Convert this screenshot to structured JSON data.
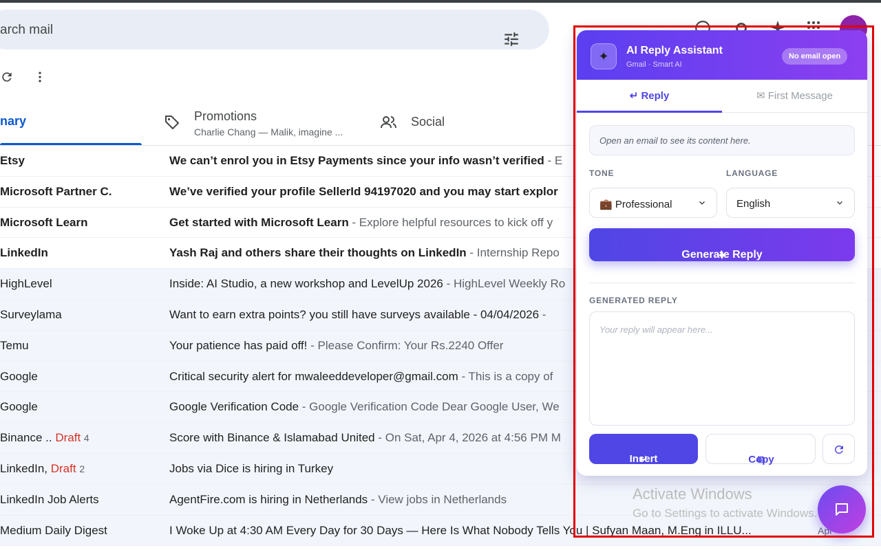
{
  "search": {
    "placeholder": "arch mail"
  },
  "tabs": {
    "primary": "nary",
    "promotions": {
      "label": "Promotions",
      "subtitle": "Charlie Chang — Malik, imagine ..."
    },
    "social": "Social"
  },
  "emails": [
    {
      "sender": "Etsy",
      "draft": "",
      "count": "",
      "subject": "We can’t enrol you in Etsy Payments since your info wasn’t verified",
      "snippet": " - E",
      "unread": true
    },
    {
      "sender": "Microsoft Partner C.",
      "draft": "",
      "count": "",
      "subject": "We’ve verified your profile SellerId 94197020 and you may start explor",
      "snippet": "",
      "unread": true
    },
    {
      "sender": "Microsoft Learn",
      "draft": "",
      "count": "",
      "subject": "Get started with Microsoft Learn",
      "snippet": " - Explore helpful resources to kick off y",
      "unread": true
    },
    {
      "sender": "LinkedIn",
      "draft": "",
      "count": "",
      "subject": "Yash Raj and others share their thoughts on LinkedIn",
      "snippet": " - Internship Repo",
      "unread": true
    },
    {
      "sender": "HighLevel",
      "draft": "",
      "count": "",
      "subject": "Inside: AI Studio, a new workshop and LevelUp 2026",
      "snippet": " - HighLevel Weekly Ro",
      "unread": false
    },
    {
      "sender": "Surveylama",
      "draft": "",
      "count": "",
      "subject": "Want to earn extra points? you still have surveys available - 04/04/2026",
      "snippet": " -",
      "unread": false
    },
    {
      "sender": "Temu",
      "draft": "",
      "count": "",
      "subject": "Your patience has paid off!",
      "snippet": " - Please Confirm: Your Rs.2240 Offer",
      "unread": false
    },
    {
      "sender": "Google",
      "draft": "",
      "count": "",
      "subject": "Critical security alert for mwaleeddeveloper@gmail.com",
      "snippet": " - This is a copy of",
      "unread": false
    },
    {
      "sender": "Google",
      "draft": "",
      "count": "",
      "subject": "Google Verification Code",
      "snippet": " - Google Verification Code Dear Google User, We",
      "unread": false
    },
    {
      "sender": "Binance .. ",
      "draft": "Draft",
      "count": "4",
      "subject": "Score with Binance & Islamabad United",
      "snippet": " - On Sat, Apr 4, 2026 at 4:56 PM M",
      "unread": false
    },
    {
      "sender": "LinkedIn, ",
      "draft": "Draft",
      "count": "2",
      "subject": "Jobs via Dice is hiring in Turkey",
      "snippet": "",
      "unread": false
    },
    {
      "sender": "LinkedIn Job Alerts",
      "draft": "",
      "count": "",
      "subject": "AgentFire.com is hiring in Netherlands",
      "snippet": " - View jobs in Netherlands",
      "unread": false
    },
    {
      "sender": "Medium Daily Digest",
      "draft": "",
      "count": "",
      "subject": "I Woke Up at 4:30 AM Every Day for 30 Days — Here Is What Nobody Tells You | Sufyan Maan, M.Eng in ILLU...",
      "snippet": "",
      "unread": false,
      "date": "Apr"
    }
  ],
  "panel": {
    "title": "AI Reply Assistant",
    "subtitle": "Gmail · Smart AI",
    "status": "No email open",
    "tab_reply": "Reply",
    "tab_first": "First Message",
    "email_placeholder": "Open an email to see its content here.",
    "tone_label": "TONE",
    "language_label": "LANGUAGE",
    "tone_value": "Professional",
    "language_value": "English",
    "generate_label": "Generate Reply",
    "generated_label": "GENERATED REPLY",
    "reply_placeholder": "Your reply will appear here...",
    "insert_label": "Insert",
    "copy_label": "Copy"
  },
  "watermark": {
    "line1": "Activate Windows",
    "line2": "Go to Settings to activate Windows."
  },
  "colors": {
    "accent": "#4f46e5",
    "header_start": "#5b3ff0",
    "header_end": "#8c3ff0",
    "highlight": "#e00000",
    "gmail_blue": "#0b57d0"
  }
}
